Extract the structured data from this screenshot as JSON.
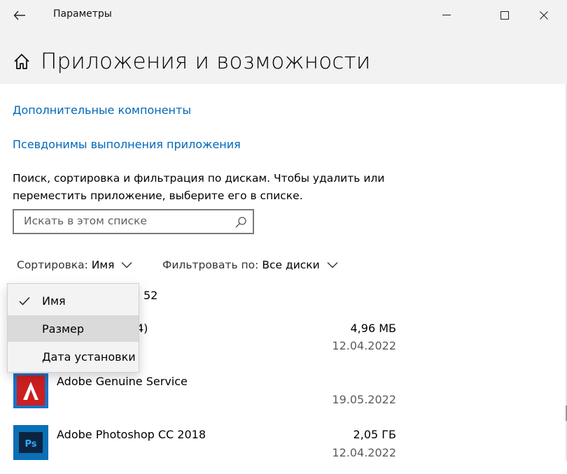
{
  "window": {
    "title": "Параметры",
    "controls": [
      "minimize",
      "maximize",
      "close"
    ]
  },
  "page": {
    "title": "Приложения и возможности"
  },
  "links": {
    "optional_features": "Дополнительные компоненты",
    "app_aliases": "Псевдонимы выполнения приложения"
  },
  "description": "Поиск, сортировка и фильтрация по дискам. Чтобы удалить или переместить приложение, выберите его в списке.",
  "search": {
    "placeholder": "Искать в этом списке"
  },
  "sort": {
    "label": "Сортировка:",
    "value": "Имя"
  },
  "filter": {
    "label": "Фильтровать по:",
    "value": "Все диски"
  },
  "count_partial": "52",
  "sort_menu": {
    "items": [
      {
        "label": "Имя",
        "checked": true
      },
      {
        "label": "Размер",
        "checked": false,
        "hovered": true
      },
      {
        "label": "Дата установки",
        "checked": false
      }
    ]
  },
  "apps": [
    {
      "name_partial": "4)",
      "size": "4,96 МБ",
      "date": "12.04.2022"
    },
    {
      "name": "Adobe Genuine Service",
      "size": "",
      "date": "19.05.2022",
      "icon": "adobe-logo-icon",
      "icon_color": "#cc1f1f"
    },
    {
      "name": "Adobe Photoshop CC 2018",
      "size": "2,05 ГБ",
      "date": "12.04.2022",
      "icon": "photoshop-icon",
      "icon_color": "#0a6fb6",
      "icon_text": "Ps"
    }
  ],
  "colors": {
    "accent_link": "#0067b8",
    "header_bg": "#f2f2f2"
  }
}
